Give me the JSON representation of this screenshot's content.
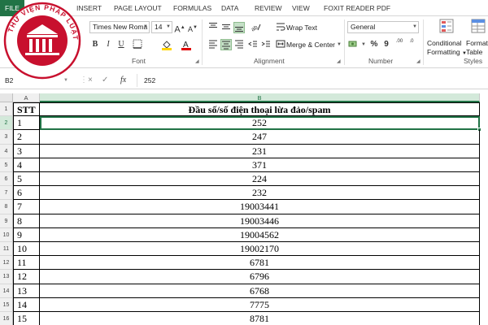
{
  "menu": {
    "file": "FILE",
    "tabs": [
      "INSERT",
      "PAGE LAYOUT",
      "FORMULAS",
      "DATA",
      "REVIEW",
      "VIEW",
      "FOXIT READER PDF"
    ]
  },
  "ribbon": {
    "font_name": "Times New Roma",
    "font_size": "14",
    "font_group_label": "Font",
    "alignment_group_label": "Alignment",
    "number_group_label": "Number",
    "styles_group_label": "Styles",
    "wrap_text": "Wrap Text",
    "merge_center": "Merge & Center",
    "number_format": "General",
    "conditional_formatting_line1": "Conditional",
    "conditional_formatting_line2": "Formatting",
    "format_table_line1": "Format",
    "format_table_line2": "Table",
    "bold": "B",
    "italic": "I",
    "underline": "U",
    "percent": "%",
    "comma": "9",
    "decimal_add": ".00",
    "decimal_remove": ".0"
  },
  "logo": {
    "text": "THƯ VIỆN PHÁP LUẬT"
  },
  "formula_bar": {
    "name_box": "B2",
    "cancel_icon": "×",
    "enter_icon": "✓",
    "fx": "fx",
    "formula": "252"
  },
  "sheet": {
    "columns": [
      "A",
      "B"
    ],
    "header": {
      "stt": "STT",
      "title": "Đầu số/số điện thoại lừa đảo/spam"
    },
    "rows": [
      {
        "num": "2",
        "stt": "1",
        "value": "252"
      },
      {
        "num": "3",
        "stt": "2",
        "value": "247"
      },
      {
        "num": "4",
        "stt": "3",
        "value": "231"
      },
      {
        "num": "5",
        "stt": "4",
        "value": "371"
      },
      {
        "num": "6",
        "stt": "5",
        "value": "224"
      },
      {
        "num": "7",
        "stt": "6",
        "value": "232"
      },
      {
        "num": "8",
        "stt": "7",
        "value": "19003441"
      },
      {
        "num": "9",
        "stt": "8",
        "value": "19003446"
      },
      {
        "num": "10",
        "stt": "9",
        "value": "19004562"
      },
      {
        "num": "11",
        "stt": "10",
        "value": "19002170"
      },
      {
        "num": "12",
        "stt": "11",
        "value": "6781"
      },
      {
        "num": "13",
        "stt": "12",
        "value": "6796"
      },
      {
        "num": "14",
        "stt": "13",
        "value": "6768"
      },
      {
        "num": "15",
        "stt": "14",
        "value": "7775"
      },
      {
        "num": "16",
        "stt": "15",
        "value": "8781"
      }
    ],
    "header_row_num": "1"
  },
  "colors": {
    "excel_green": "#217346",
    "logo_red": "#c8102e"
  }
}
